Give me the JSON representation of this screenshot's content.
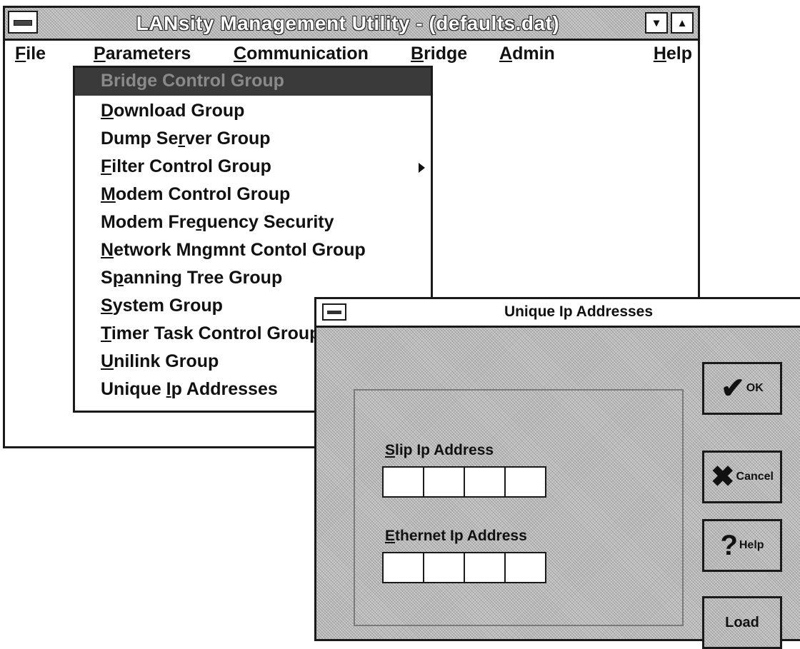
{
  "main_window": {
    "title": "LANsity Management Utility - (defaults.dat)",
    "controls": {
      "minimize": "▾",
      "maximize": "▴"
    }
  },
  "menu_bar": {
    "items": [
      {
        "pre": "",
        "key": "F",
        "post": "ile"
      },
      {
        "pre": "",
        "key": "P",
        "post": "arameters"
      },
      {
        "pre": "",
        "key": "C",
        "post": "ommunication"
      },
      {
        "pre": "",
        "key": "B",
        "post": "ridge"
      },
      {
        "pre": "",
        "key": "A",
        "post": "dmin"
      },
      {
        "pre": "",
        "key": "H",
        "post": "elp"
      }
    ]
  },
  "parameters_menu": {
    "items": [
      {
        "pre": "",
        "key": "",
        "post": "Bridge Control Group",
        "highlighted": true
      },
      {
        "pre": "",
        "key": "D",
        "post": "ownload Group"
      },
      {
        "pre": "Dump Se",
        "key": "r",
        "post": "ver Group"
      },
      {
        "pre": "",
        "key": "F",
        "post": "ilter Control Group",
        "submenu": true
      },
      {
        "pre": "",
        "key": "M",
        "post": "odem Control Group"
      },
      {
        "pre": "Modem Fre",
        "key": "q",
        "post": "uency Security"
      },
      {
        "pre": "",
        "key": "N",
        "post": "etwork Mngmnt Contol Group"
      },
      {
        "pre": "S",
        "key": "p",
        "post": "anning Tree Group"
      },
      {
        "pre": "",
        "key": "S",
        "post": "ystem Group"
      },
      {
        "pre": "",
        "key": "T",
        "post": "imer Task Control Group"
      },
      {
        "pre": "",
        "key": "U",
        "post": "nilink Group"
      },
      {
        "pre": "Unique ",
        "key": "I",
        "post": "p Addresses"
      }
    ]
  },
  "dialog": {
    "title": "Unique Ip Addresses",
    "slip_label": {
      "pre": "",
      "key": "S",
      "post": "lip Ip Address"
    },
    "ethernet_label": {
      "pre": "",
      "key": "E",
      "post": "thernet Ip Address"
    },
    "slip_octets": [
      "",
      "",
      "",
      ""
    ],
    "ethernet_octets": [
      "",
      "",
      "",
      ""
    ],
    "buttons": {
      "ok": {
        "icon": "✔",
        "label": "OK"
      },
      "cancel": {
        "icon": "✖",
        "label": "Cancel"
      },
      "help": {
        "icon": "?",
        "label": "Help"
      },
      "load": {
        "label": "Load"
      }
    }
  }
}
